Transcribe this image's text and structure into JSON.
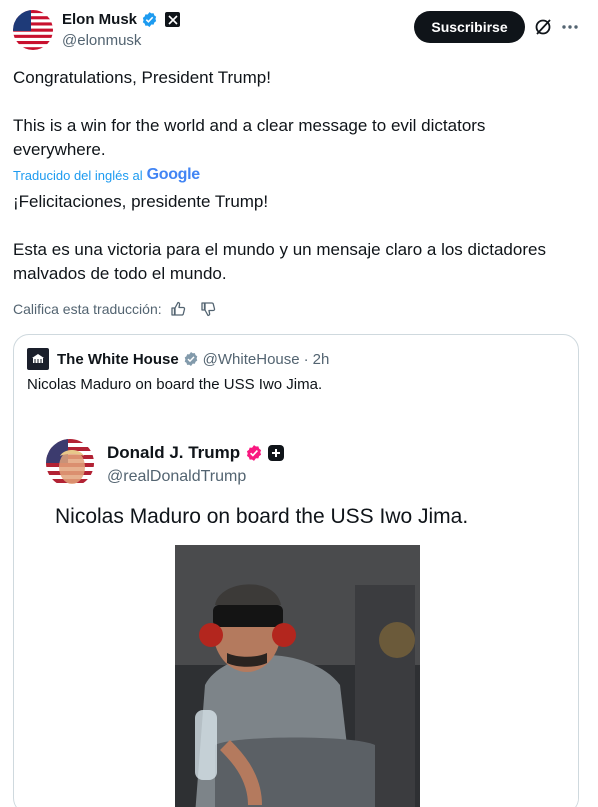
{
  "author": {
    "name": "Elon Musk",
    "handle": "@elonmusk",
    "subscribe_label": "Suscribirse"
  },
  "tweet": {
    "text_line1": "Congratulations, President Trump!",
    "text_line2": "This is a win for the world and a clear message to evil dictators everywhere.",
    "translated_label": "Traducido del inglés al",
    "translator": "Google",
    "translation_line1": "¡Felicitaciones, presidente Trump!",
    "translation_line2": "Esta es una victoria para el mundo y un mensaje claro a los dictadores malvados de todo el mundo.",
    "rate_label": "Califica esta traducción:"
  },
  "quote": {
    "name": "The White House",
    "handle": "@WhiteHouse",
    "separator": "·",
    "time": "2h",
    "text": "Nicolas Maduro on board the USS Iwo Jima.",
    "embedded": {
      "name": "Donald J. Trump",
      "handle": "@realDonaldTrump",
      "text": "Nicolas Maduro on board the USS Iwo Jima."
    }
  },
  "colors": {
    "accent": "#1d9bf0",
    "trump_badge": "#f91880"
  },
  "icons": [
    "verified-icon",
    "x-logo-icon",
    "grok-icon",
    "more-icon",
    "thumbs-up-icon",
    "thumbs-down-icon"
  ]
}
